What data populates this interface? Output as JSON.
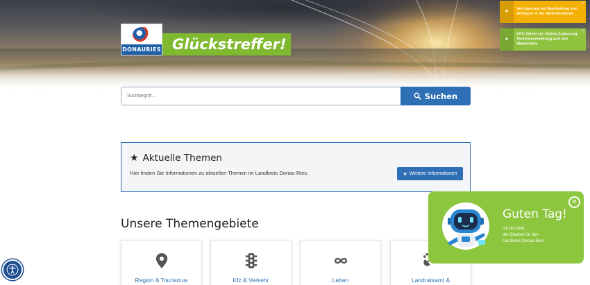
{
  "header": {
    "logo_text": "DONAURIES",
    "brand_tagline": "Glückstreffer!"
  },
  "notifications": [
    {
      "icon": "star-icon",
      "text": "Verzögerung bei Bearbeitung von Anträgen in der Waffenbehörde",
      "color": "#f3b000"
    },
    {
      "icon": "dot-icon",
      "text": "KFZ: Direkt zur Online-Zulassung, Terminreservierung und den Wartezeiten",
      "color": "#8fc23f"
    }
  ],
  "search": {
    "placeholder": "Suchbegriff...",
    "button_label": "Suchen"
  },
  "news": {
    "title": "Aktuelle Themen",
    "description": "Hier finden Sie Informationen zu aktuellen Themen im Landkreis Donau-Ries.",
    "button_label": "Weitere Informationen"
  },
  "themes": {
    "title": "Unsere Themengebiete",
    "cards": [
      {
        "label": "Region & Tourismus",
        "icon": "map-pin-icon"
      },
      {
        "label": "Kfz & Verkehr",
        "icon": "traffic-light-icon"
      },
      {
        "label": "Leben",
        "icon": "infinity-icon"
      },
      {
        "label": "Landratsamt &",
        "icon": "satellite-dish-icon"
      }
    ]
  },
  "chatbot": {
    "greeting": "Guten Tag!",
    "intro_line1": "Ich bin Dolli,",
    "intro_line2": "der Chatbot für den",
    "intro_line3": "Landkreis Donau-Ries"
  },
  "colors": {
    "primary_blue": "#2f6fb5",
    "brand_green": "#8cc63f",
    "notice_orange": "#f3b000"
  }
}
